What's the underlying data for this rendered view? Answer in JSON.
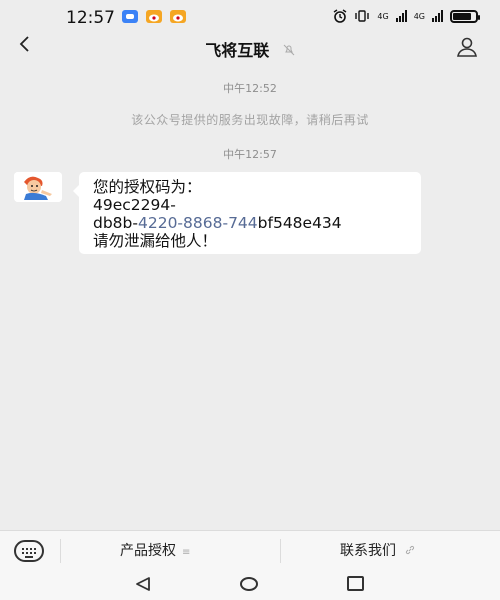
{
  "status_bar": {
    "time": "12:57",
    "network_1": "4G",
    "network_2": "4G",
    "battery_level": 0.9
  },
  "header": {
    "title": "飞将互联",
    "mute_icon": "bell-off-icon",
    "profile_icon": "person-icon"
  },
  "chat": {
    "timestamp_1": "中午12:52",
    "system_message": "该公众号提供的服务出现故障，请稍后再试",
    "timestamp_2": "中午12:57",
    "message": {
      "line1": "您的授权码为：",
      "line2": "49ec2294-",
      "line3_prefix": "db8b-",
      "line3_link": "4220-8868-744",
      "line3_suffix": "bf548e434",
      "line4": "请勿泄漏给他人！"
    }
  },
  "menu": {
    "items": [
      {
        "label": "产品授权",
        "icon": "≡"
      },
      {
        "label": "联系我们",
        "icon": "🔗"
      }
    ]
  },
  "colors": {
    "background": "#ededed",
    "link": "#576b95"
  }
}
